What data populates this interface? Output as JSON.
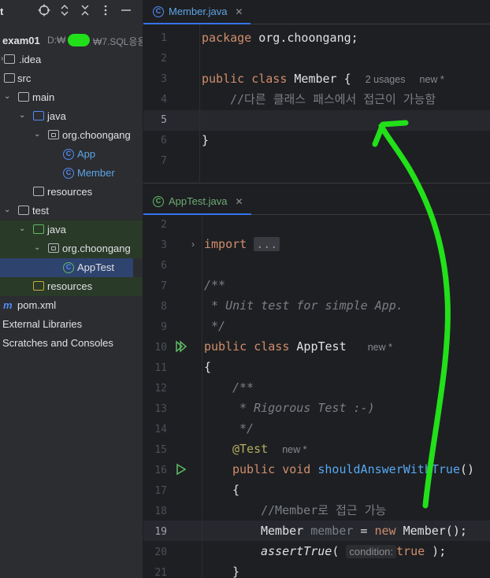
{
  "project": {
    "title": "t",
    "root": {
      "name": "exam01",
      "path": "D:₩",
      "path_tail": "₩7.SQL응용"
    },
    "items": [
      {
        "label": ".idea"
      },
      {
        "label": "src"
      },
      {
        "label": "main"
      },
      {
        "label": "java"
      },
      {
        "label": "org.choongang"
      },
      {
        "label": "App"
      },
      {
        "label": "Member"
      },
      {
        "label": "resources"
      },
      {
        "label": "test"
      },
      {
        "label": "java"
      },
      {
        "label": "org.choongang"
      },
      {
        "label": "AppTest"
      },
      {
        "label": "resources"
      },
      {
        "label": "pom.xml"
      },
      {
        "label": "External Libraries"
      },
      {
        "label": "Scratches and Consoles"
      }
    ]
  },
  "editor_top": {
    "tab_label": "Member.java",
    "line_numbers": [
      "1",
      "2",
      "3",
      "4",
      "5",
      "6",
      "7"
    ],
    "line1": {
      "kw": "package",
      "rest": " org.choongang;"
    },
    "line3": {
      "kw1": "public",
      "kw2": "class",
      "name": " Member {",
      "usages": "2 usages",
      "new": "new *"
    },
    "line4": "//다른 클래스 패스에서 접근이 가능함",
    "line6": "}"
  },
  "editor_bottom": {
    "tab_label": "AppTest.java",
    "line_numbers": [
      "2",
      "3",
      "6",
      "7",
      "8",
      "9",
      "10",
      "11",
      "12",
      "13",
      "14",
      "15",
      "16",
      "17",
      "18",
      "19",
      "20",
      "21"
    ],
    "import_kw": "import",
    "import_fold": "...",
    "doc_open": "/**",
    "doc_text": " * Unit test for simple App.",
    "doc_close": " */",
    "class_line": {
      "kw1": "public",
      "kw2": "class",
      "name": " AppTest",
      "new": "new *"
    },
    "brace_open": "{",
    "doc2_open": "/**",
    "doc2_text": " * Rigorous Test :-)",
    "doc2_close": " */",
    "annotation": "@Test",
    "annotation_new": "new *",
    "method_line": {
      "kw1": "public",
      "kw2": "void",
      "name": "shouldAnswerWithTrue",
      "rest": "()"
    },
    "method_brace": "{",
    "comment": "//Member로 접근 가능",
    "decl_line": {
      "type": "Member",
      "var": " member",
      "eq": " = ",
      "kw": "new",
      "rest": " Member();"
    },
    "assert_line": {
      "fn": "assertTrue",
      "open": "( ",
      "hint": "condition:",
      "kw": "true",
      "close": " );"
    },
    "close_brace": "}"
  },
  "colors": {
    "keyword": "#cf8e6d",
    "comment": "#7a7e85",
    "method": "#56a8f5",
    "annotation": "#b3ae60",
    "annotation_stroke": "#22e01a"
  },
  "icons": [
    "target-icon",
    "expand-all-icon",
    "collapse-all-icon",
    "more-icon",
    "minimize-icon",
    "folder-icon",
    "package-icon",
    "class-icon",
    "test-class-icon",
    "maven-icon",
    "run-gutter-icon",
    "fold-arrow-icon",
    "close-icon"
  ]
}
